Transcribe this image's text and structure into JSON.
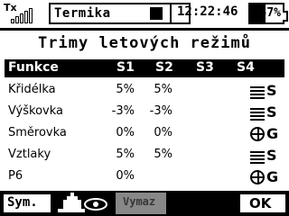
{
  "status_bar": {
    "tx_label": "Tx",
    "tx_signal_bars": 5,
    "model_name": "Termika",
    "clock": "12:22:46",
    "battery_text": "57%",
    "battery_level": 0.57
  },
  "screen_title": "Trimy letových režimů",
  "table": {
    "headers": [
      "Funkce",
      "S1",
      "S2",
      "S3",
      "S4"
    ],
    "rows": [
      {
        "name": "Křidélka",
        "s1": "5%",
        "s2": "5%",
        "s3": "",
        "s4": "",
        "mode_icon": "sym-stripes-icon",
        "mode_letter": "S"
      },
      {
        "name": "Výškovka",
        "s1": "-3%",
        "s2": "-3%",
        "s3": "",
        "s4": "",
        "mode_icon": "sym-stripes-icon",
        "mode_letter": "S"
      },
      {
        "name": "Směrovka",
        "s1": "0%",
        "s2": "0%",
        "s3": "",
        "s4": "",
        "mode_icon": "globe-icon",
        "mode_letter": "G"
      },
      {
        "name": "Vztlaky",
        "s1": "5%",
        "s2": "5%",
        "s3": "",
        "s4": "",
        "mode_icon": "sym-stripes-icon",
        "mode_letter": "S"
      },
      {
        "name": "P6",
        "s1": "0%",
        "s2": "",
        "s3": "",
        "s4": "",
        "mode_icon": "globe-icon",
        "mode_letter": "G"
      }
    ]
  },
  "softkeys": {
    "sym_label": "Sym.",
    "eye_icon": "model-eye-icon",
    "vymaz_label": "Vymaz",
    "ok_label": "OK"
  }
}
